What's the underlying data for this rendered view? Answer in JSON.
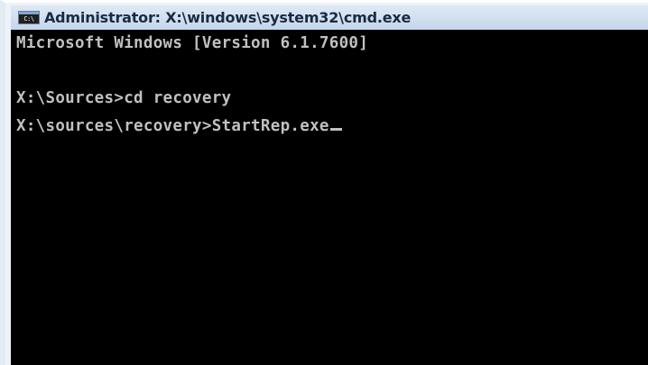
{
  "window": {
    "title": "Administrator: X:\\windows\\system32\\cmd.exe",
    "icon": "cmd-icon",
    "icon_text": "C:\\"
  },
  "console": {
    "lines": [
      "Microsoft Windows [Version 6.1.7600]",
      "",
      "X:\\Sources>cd recovery",
      "X:\\sources\\recovery>StartRep.exe"
    ],
    "background": "#000000",
    "foreground": "#c0c0c0"
  },
  "colors": {
    "titlebar": "#d3e1f1",
    "title_text": "#1b2a44"
  }
}
